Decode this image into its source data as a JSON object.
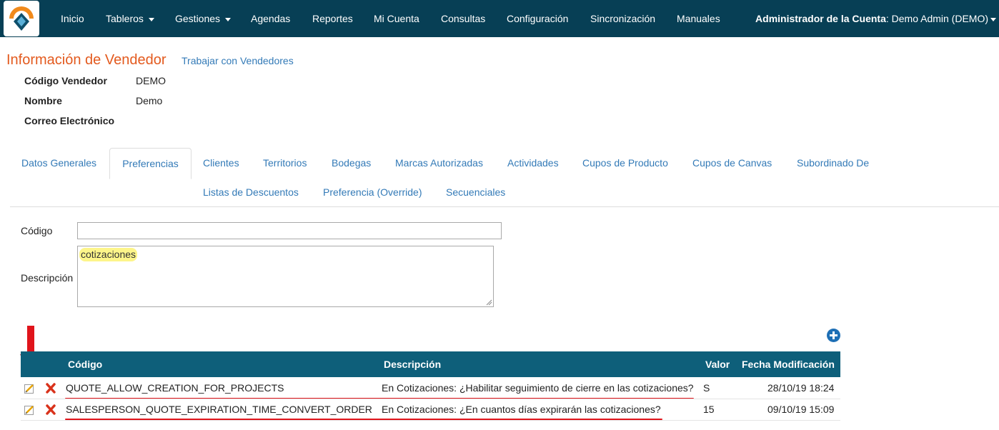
{
  "nav": {
    "logo": "company-logo",
    "items": [
      {
        "label": "Inicio"
      },
      {
        "label": "Tableros",
        "dropdown": true
      },
      {
        "label": "Gestiones",
        "dropdown": true
      },
      {
        "label": "Agendas"
      },
      {
        "label": "Reportes"
      },
      {
        "label": "Mi Cuenta"
      },
      {
        "label": "Consultas"
      },
      {
        "label": "Configuración"
      },
      {
        "label": "Sincronización"
      },
      {
        "label": "Manuales"
      }
    ],
    "account_label": "Administrador de la Cuenta",
    "account_user": ": Demo Admin (DEMO)"
  },
  "page": {
    "title": "Información de Vendedor",
    "back_link": "Trabajar con Vendedores"
  },
  "vendor": {
    "code_label": "Código Vendedor",
    "code_value": "DEMO",
    "name_label": "Nombre",
    "name_value": "Demo",
    "email_label": "Correo Electrónico",
    "email_value": ""
  },
  "tabs": {
    "row1": [
      "Datos Generales",
      "Preferencias",
      "Clientes",
      "Territorios",
      "Bodegas",
      "Marcas Autorizadas",
      "Actividades",
      "Cupos de Producto",
      "Cupos de Canvas",
      "Subordinado De"
    ],
    "row2": [
      "Listas de Descuentos",
      "Preferencia (Override)",
      "Secuenciales"
    ],
    "active": "Preferencias"
  },
  "filter": {
    "code_label": "Código",
    "code_value": "",
    "desc_label": "Descripción",
    "desc_value": "cotizaciones"
  },
  "table": {
    "add_icon": "plus-circle-icon",
    "columns": [
      "Código",
      "Descripción",
      "Valor",
      "Fecha Modificación"
    ],
    "rows": [
      {
        "code": "QUOTE_ALLOW_CREATION_FOR_PROJECTS",
        "description": "En Cotizaciones: ¿Habilitar seguimiento de cierre en las cotizaciones?",
        "value": "S",
        "modified": "28/10/19 18:24"
      },
      {
        "code": "SALESPERSON_QUOTE_EXPIRATION_TIME_CONVERT_ORDER",
        "description": "En Cotizaciones: ¿En cuantos días expirarán las cotizaciones?",
        "value": "15",
        "modified": "09/10/19 15:09"
      }
    ]
  },
  "colors": {
    "navbar": "#073f55",
    "title_orange": "#e35a1e",
    "link_blue": "#337ab7",
    "table_header": "#0e5f7a",
    "annotation_red": "#e0141b",
    "highlight_yellow": "#fdf58a"
  }
}
